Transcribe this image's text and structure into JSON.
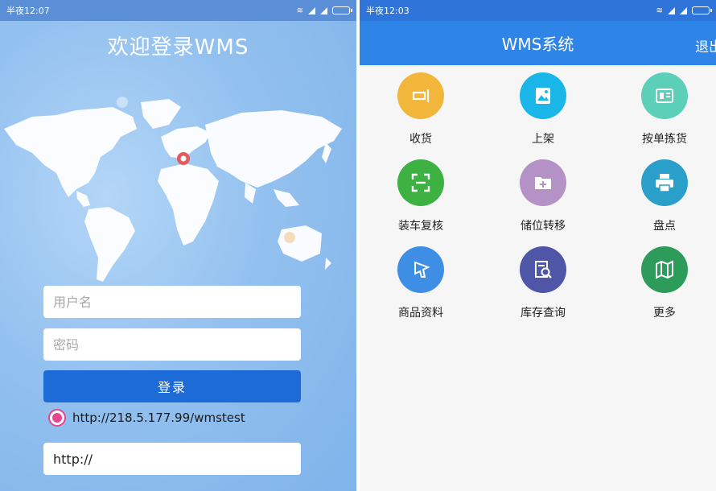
{
  "left": {
    "status_time": "半夜12:07",
    "title": "欢迎登录WMS",
    "username_placeholder": "用户名",
    "password_placeholder": "密码",
    "login_label": "登录",
    "server_option": "http://218.5.177.99/wmstest",
    "server_input_value": "http://"
  },
  "right": {
    "status_time": "半夜12:03",
    "title": "WMS系统",
    "logout_label": "退出",
    "tiles": [
      {
        "label": "收货",
        "color": "#f2b63a",
        "icon": "receive-icon"
      },
      {
        "label": "上架",
        "color": "#1ab6e8",
        "icon": "shelve-icon"
      },
      {
        "label": "按单拣货",
        "color": "#5ccfb8",
        "icon": "pick-order-icon"
      },
      {
        "label": "装车复核",
        "color": "#3db142",
        "icon": "load-check-icon"
      },
      {
        "label": "储位转移",
        "color": "#b592c6",
        "icon": "location-transfer-icon"
      },
      {
        "label": "盘点",
        "color": "#2a9fc9",
        "icon": "stocktake-icon"
      },
      {
        "label": "商品资料",
        "color": "#3f8ee6",
        "icon": "product-info-icon"
      },
      {
        "label": "库存查询",
        "color": "#4f56a8",
        "icon": "inventory-query-icon"
      },
      {
        "label": "更多",
        "color": "#2d9c5a",
        "icon": "more-icon"
      }
    ]
  }
}
